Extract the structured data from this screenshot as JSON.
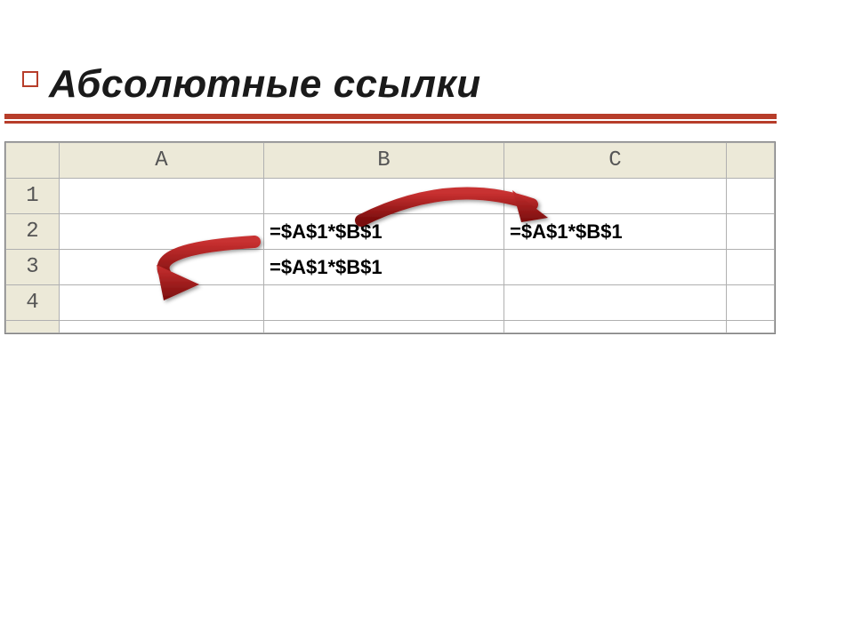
{
  "title": "Абсолютные ссылки",
  "columns": {
    "A": "A",
    "B": "B",
    "C": "C"
  },
  "rows": {
    "r1": "1",
    "r2": "2",
    "r3": "3",
    "r4": "4"
  },
  "cells": {
    "B2": "=$A$1*$B$1",
    "C2": "=$A$1*$B$1",
    "B3": "=$A$1*$B$1"
  },
  "colors": {
    "accent": "#b73d2a",
    "header_bg": "#ece9d8",
    "arrow_fill": "#a61c1c"
  }
}
